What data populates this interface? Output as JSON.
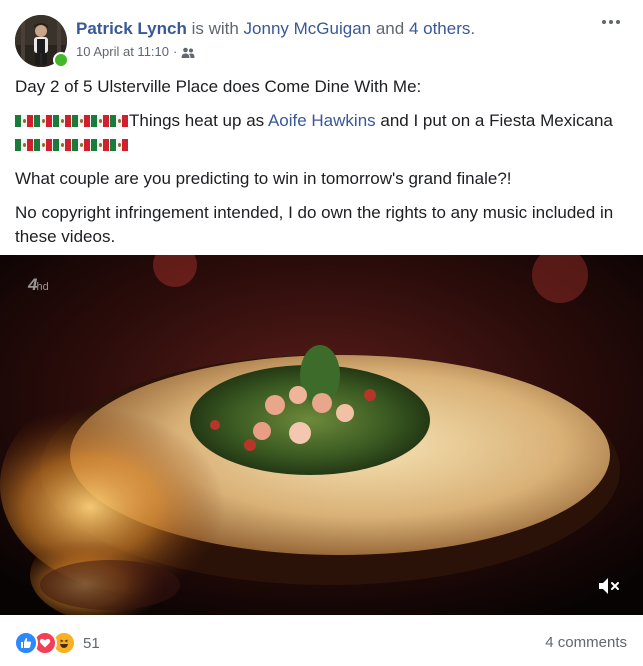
{
  "post": {
    "author": "Patrick Lynch",
    "with_text": " is with ",
    "tagged_person": "Jonny McGuigan",
    "and_text": " and ",
    "others_link": "4 others",
    "period": ".",
    "timestamp": "10 April at 11:10",
    "separator": "·",
    "audience_icon": "friends-icon",
    "more_icon": "more-options-icon"
  },
  "content": {
    "line1": "Day 2 of 5 Ulsterville Place does Come Dine With Me:",
    "line2_before": "Things heat up as ",
    "line2_mention": "Aoife Hawkins",
    "line2_after": " and I put on a Fiesta Mexicana",
    "line3": "What couple are you predicting to win in tomorrow's grand finale?!",
    "line4": "No copyright infringement intended, I do own the rights to any music included in these videos."
  },
  "video": {
    "watermark": "4",
    "watermark_suffix": "hd",
    "mute_icon": "volume-muted-icon"
  },
  "footer": {
    "reaction_count": "51",
    "comments": "4 comments"
  },
  "colors": {
    "link": "#385898",
    "muted": "#616770",
    "like": "#2d88ff",
    "love": "#f33e58",
    "haha": "#f7b125",
    "online": "#42b72a"
  }
}
